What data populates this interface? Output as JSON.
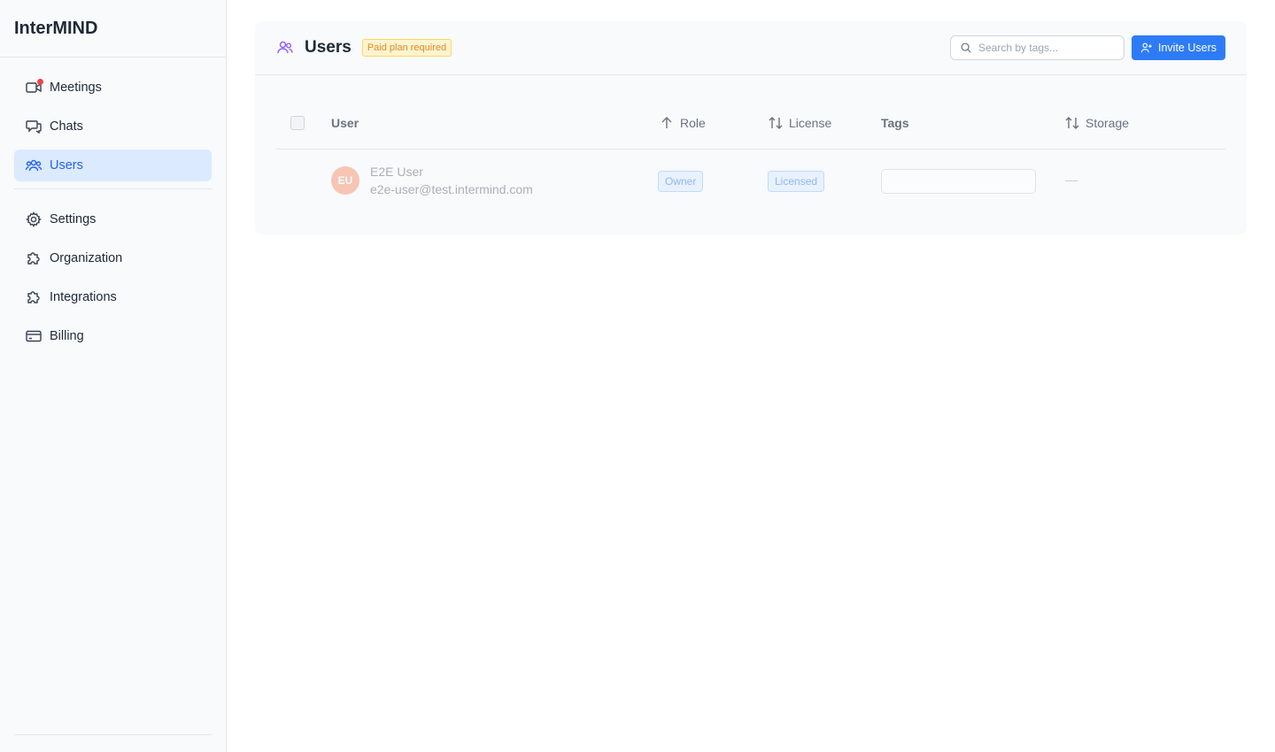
{
  "app": {
    "name": "InterMIND"
  },
  "sidebar": {
    "items": [
      {
        "label": "Meetings",
        "icon": "video-camera-icon",
        "notification": true
      },
      {
        "label": "Chats",
        "icon": "chat-bubbles-icon"
      },
      {
        "label": "Users",
        "icon": "users-icon",
        "active": true
      },
      {
        "label": "Settings",
        "icon": "gear-icon"
      },
      {
        "label": "Organization",
        "icon": "puzzle-icon"
      },
      {
        "label": "Integrations",
        "icon": "puzzle-icon"
      },
      {
        "label": "Billing",
        "icon": "credit-card-icon"
      }
    ]
  },
  "header": {
    "title": "Users",
    "plan_badge": "Paid plan required",
    "search_placeholder": "Search by tags...",
    "invite_label": "Invite Users"
  },
  "table": {
    "columns": [
      {
        "label": "User",
        "sort": "none"
      },
      {
        "label": "Role",
        "sort": "ascending"
      },
      {
        "label": "License",
        "sort": "sortable"
      },
      {
        "label": "Tags",
        "sort": "none"
      },
      {
        "label": "Storage",
        "sort": "sortable"
      }
    ],
    "rows": [
      {
        "initials": "EU",
        "name": "E2E User",
        "email": "e2e-user@test.intermind.com",
        "role": "Owner",
        "license": "Licensed",
        "tags": "",
        "storage": "—"
      }
    ]
  },
  "colors": {
    "accent": "#2d7cf6",
    "active_nav_bg": "#dbeafe",
    "notification": "#ef4444",
    "avatar": "#f59b7a",
    "badge_warning": "#d97706"
  }
}
